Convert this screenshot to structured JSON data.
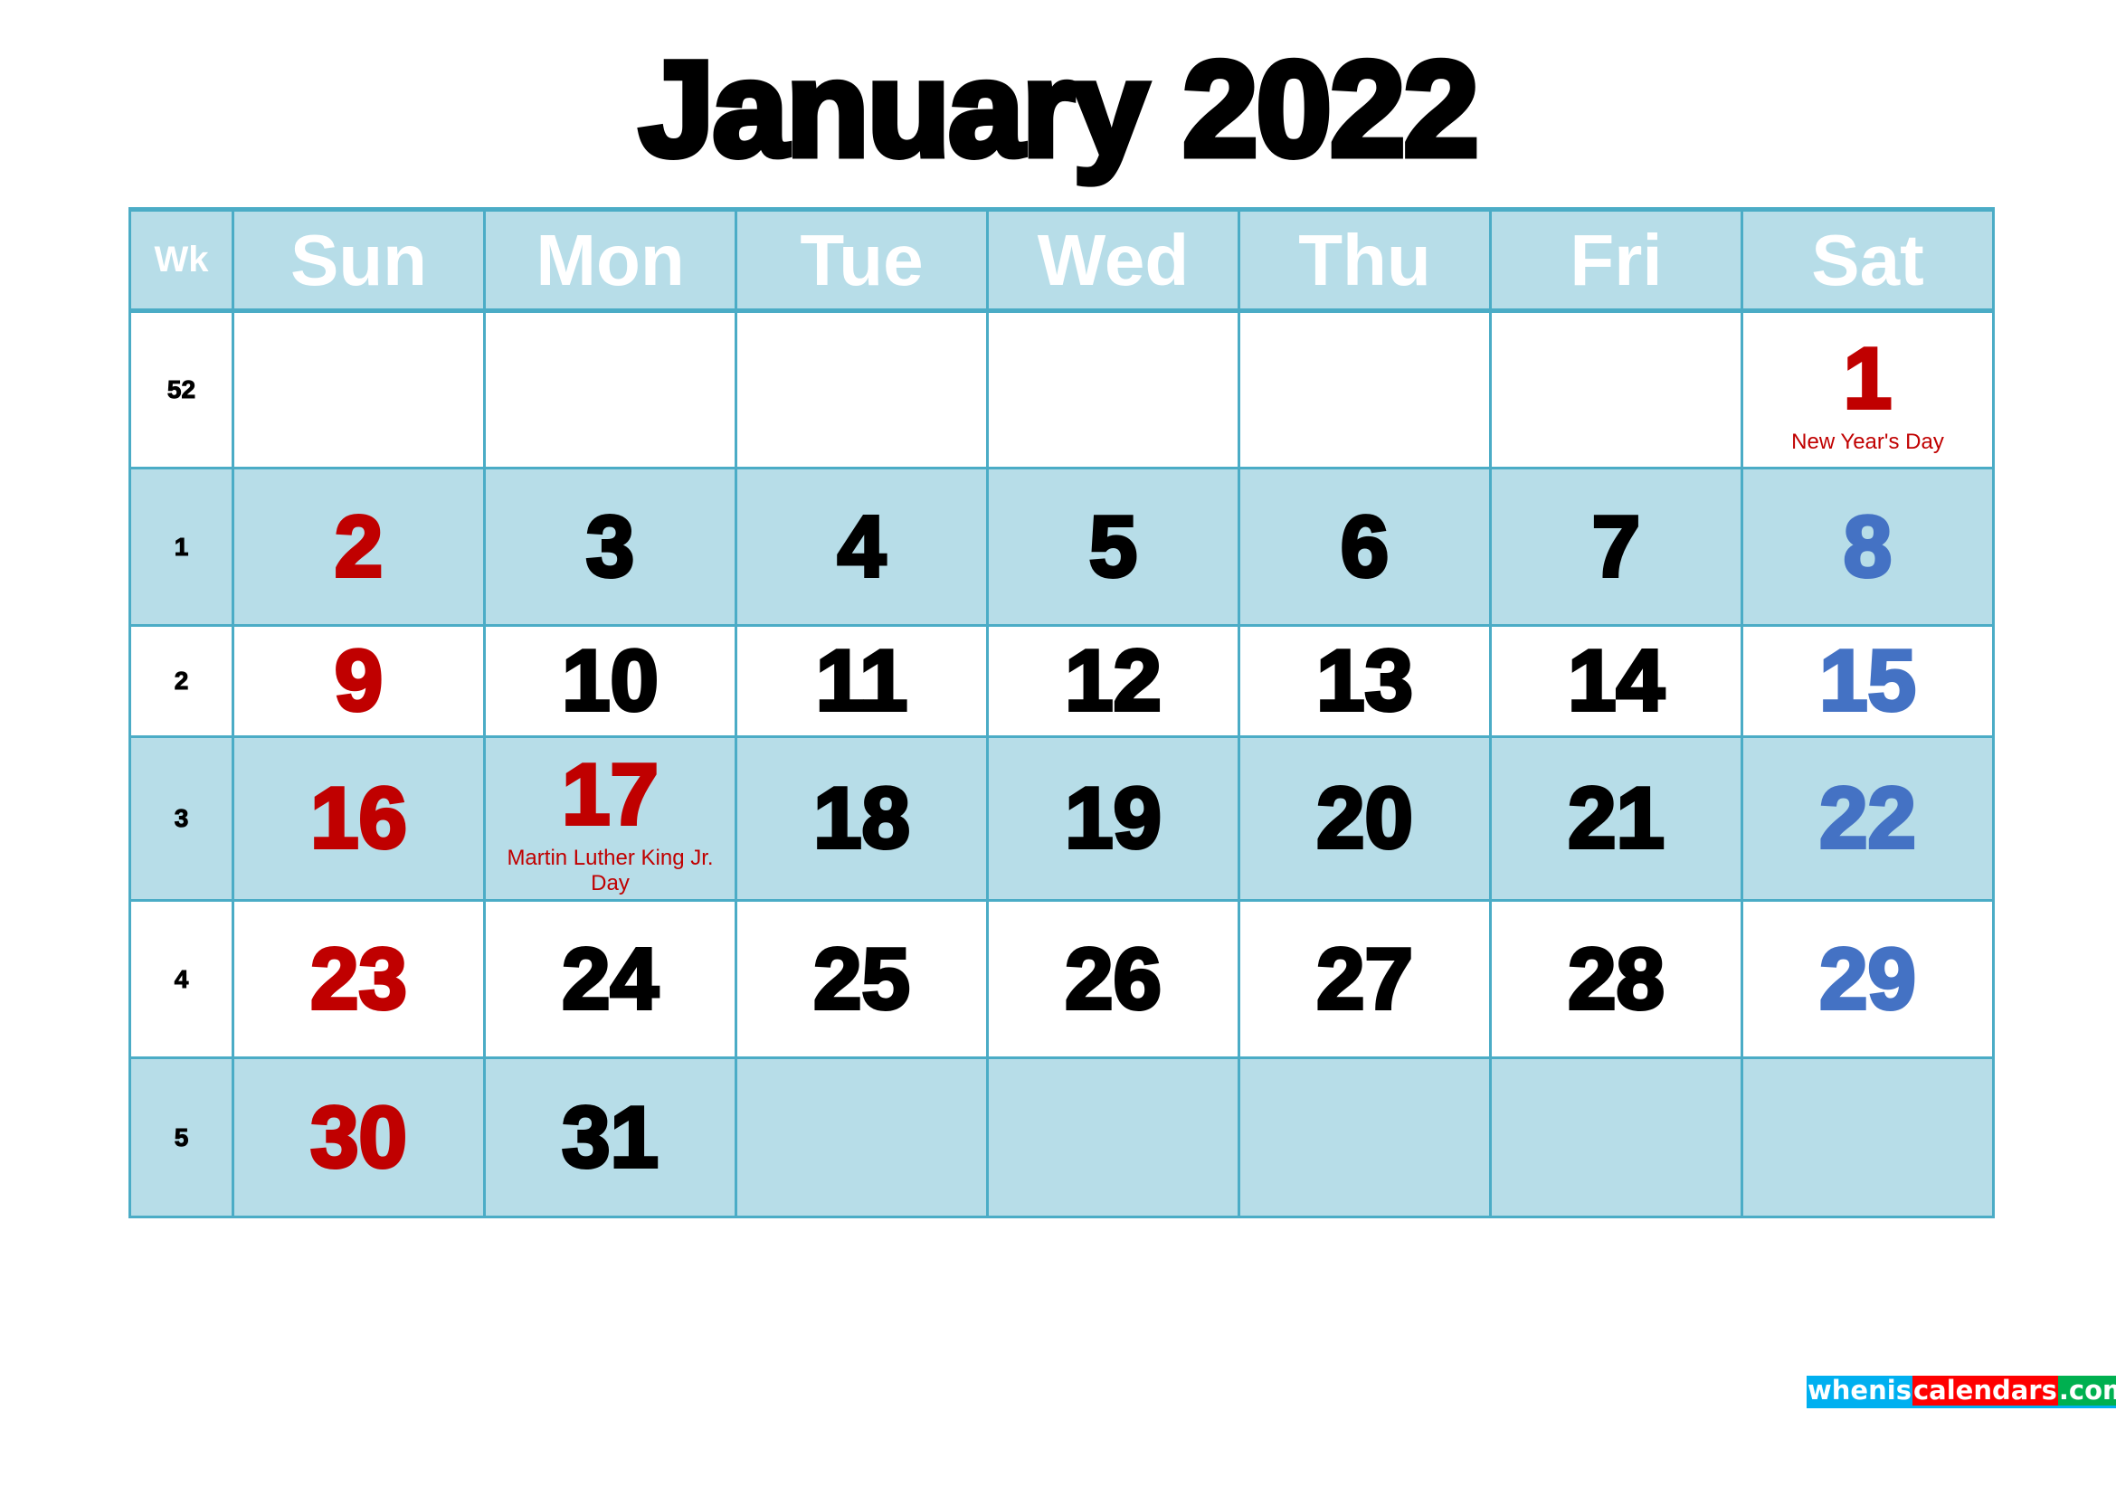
{
  "title": "January 2022",
  "month": "January",
  "year": "2022",
  "header": {
    "week_label": "Wk",
    "days": [
      "Sun",
      "Mon",
      "Tue",
      "Wed",
      "Thu",
      "Fri",
      "Sat"
    ]
  },
  "colors": {
    "border": "#4bacc6",
    "shade": "#b7dde8",
    "sunday_holiday": "#c00000",
    "saturday": "#4472c4",
    "weekday": "#000000"
  },
  "weeks": [
    {
      "wk": "52",
      "shaded": false,
      "days": [
        "",
        "",
        "",
        "",
        "",
        "",
        "1"
      ],
      "holidays": {
        "6": "New Year's Day"
      }
    },
    {
      "wk": "1",
      "shaded": true,
      "days": [
        "2",
        "3",
        "4",
        "5",
        "6",
        "7",
        "8"
      ],
      "holidays": {}
    },
    {
      "wk": "2",
      "shaded": false,
      "days": [
        "9",
        "10",
        "11",
        "12",
        "13",
        "14",
        "15"
      ],
      "holidays": {}
    },
    {
      "wk": "3",
      "shaded": true,
      "days": [
        "16",
        "17",
        "18",
        "19",
        "20",
        "21",
        "22"
      ],
      "holidays": {
        "1": "Martin Luther King Jr. Day"
      }
    },
    {
      "wk": "4",
      "shaded": false,
      "days": [
        "23",
        "24",
        "25",
        "26",
        "27",
        "28",
        "29"
      ],
      "holidays": {}
    },
    {
      "wk": "5",
      "shaded": true,
      "days": [
        "30",
        "31",
        "",
        "",
        "",
        "",
        ""
      ],
      "holidays": {}
    }
  ],
  "row_layout_note": "",
  "watermark": {
    "part1": "whenis",
    "part2": "calendars",
    "part3": ".com"
  }
}
